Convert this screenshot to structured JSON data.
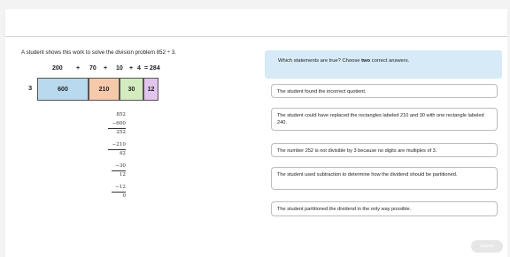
{
  "problem": {
    "prompt": "A student shows this work to solve the division problem 852 ÷ 3.",
    "addends": [
      "200",
      "+",
      "70",
      "+",
      "10",
      "+",
      "4",
      "= 284"
    ],
    "divisor": "3",
    "rectangles": [
      "600",
      "210",
      "30",
      "12"
    ],
    "long_division": [
      "852",
      "−600",
      "252",
      "−210",
      "42",
      "−30",
      "12",
      "−12",
      "0"
    ]
  },
  "question": {
    "text_before": "Which statements are true? Choose ",
    "text_bold": "two",
    "text_after": " correct answers."
  },
  "options": [
    "The student found the incorrect quotient.",
    "The student could have replaced the rectangles labeled 210 and 30 with one rectangle labeled 240.",
    "The number 252 is not divisible by 3 because no digits are multiples of 3.",
    "The student used subtraction to determine how the dividend should be partitioned.",
    "The student partitioned the dividend in the only way possible."
  ],
  "submit_label": "Submit",
  "colors": {
    "rect_600": "#b8d9ee",
    "rect_210": "#f5c9a9",
    "rect_30": "#d3ebbe",
    "rect_12": "#e2c4ec",
    "question_bg": "#d6eaf7"
  }
}
